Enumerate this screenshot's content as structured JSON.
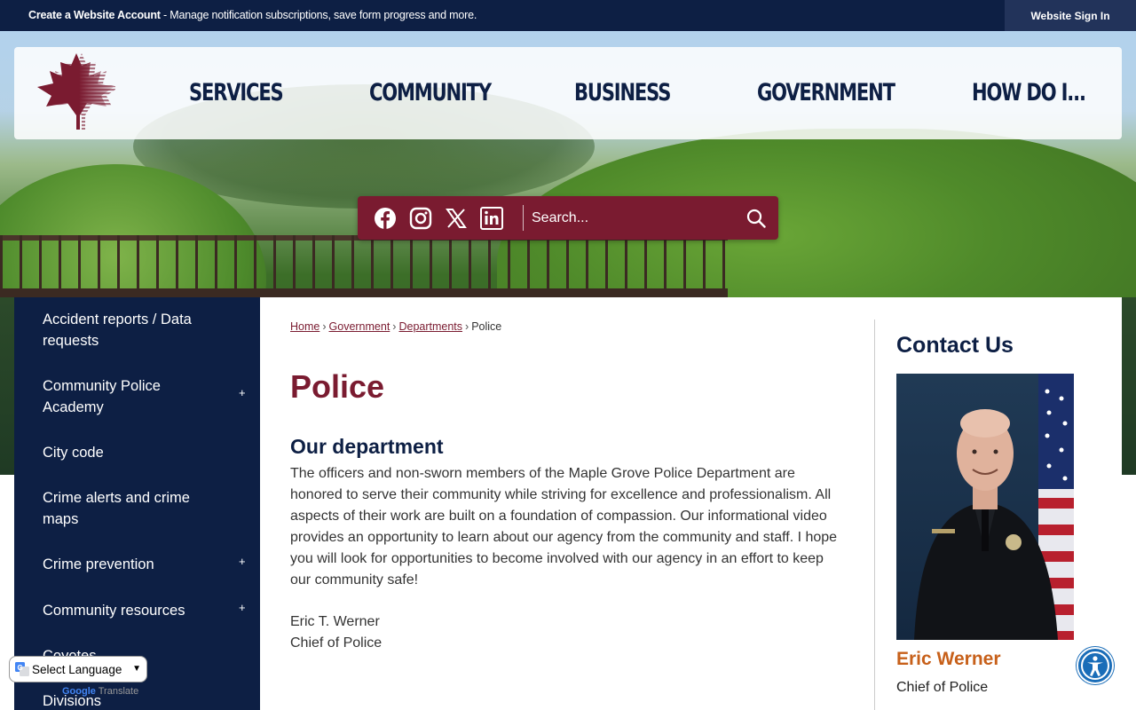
{
  "topbar": {
    "account_title": "Create a Website Account",
    "account_desc": " - Manage notification subscriptions, save form progress and more.",
    "signin_label": "Website Sign In"
  },
  "nav": {
    "items": [
      {
        "label": "SERVICES"
      },
      {
        "label": "COMMUNITY"
      },
      {
        "label": "BUSINESS"
      },
      {
        "label": "GOVERNMENT"
      },
      {
        "label": "HOW DO I..."
      }
    ]
  },
  "social": [
    "facebook-icon",
    "instagram-icon",
    "x-icon",
    "linkedin-icon"
  ],
  "search": {
    "placeholder": "Search..."
  },
  "sidebar": {
    "items": [
      {
        "label": "Accident reports / Data requests",
        "has_toggle": false
      },
      {
        "label": "Community Police Academy",
        "has_toggle": true
      },
      {
        "label": "City code",
        "has_toggle": false
      },
      {
        "label": "Crime alerts and crime maps",
        "has_toggle": false
      },
      {
        "label": "Crime prevention",
        "has_toggle": true
      },
      {
        "label": "Community resources",
        "has_toggle": true
      },
      {
        "label": "Coyotes",
        "has_toggle": false
      },
      {
        "label": "Divisions",
        "has_toggle": false
      }
    ],
    "toggle_symbol": "+"
  },
  "breadcrumb": {
    "home": "Home",
    "government": "Government",
    "departments": "Departments",
    "current": "Police",
    "sep": "›"
  },
  "content": {
    "title": "Police",
    "subtitle": "Our department",
    "body": "The officers and non-sworn members of the Maple Grove Police Department are honored to serve their community while striving for excellence and professionalism. All aspects of their work are built on a foundation of compassion. Our informational video provides an opportunity to learn about our agency from the community and staff. I hope you will look for opportunities to become involved with our agency in an effort to keep our community safe!",
    "sig_name": "Eric T. Werner",
    "sig_role": "Chief of Police"
  },
  "contact": {
    "title": "Contact Us",
    "name": "Eric Werner",
    "role": "Chief of Police"
  },
  "translate": {
    "select_label": "Select Language",
    "powered_by": "Google",
    "powered_suffix": "Translate"
  },
  "colors": {
    "navy": "#0d1f44",
    "maroon": "#7a1b30",
    "orange": "#c7601a",
    "accessibility_blue": "#1a6db8"
  }
}
